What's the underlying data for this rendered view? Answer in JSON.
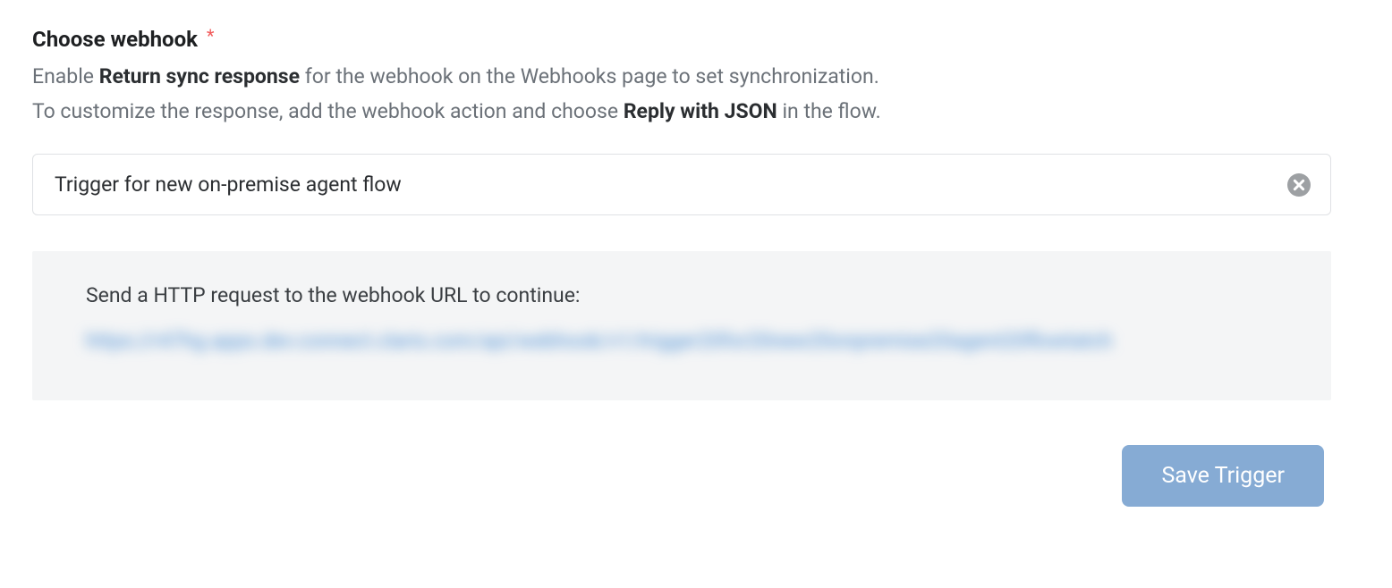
{
  "section": {
    "label": "Choose webhook",
    "required_mark": "*",
    "help_prefix": "Enable ",
    "help_bold1": "Return sync response",
    "help_mid1": " for the webhook on the Webhooks page to set synchronization.",
    "help_line2_pre": "To customize the response, add the webhook action and choose ",
    "help_bold2": "Reply with JSON",
    "help_line2_post": " in the flow."
  },
  "select": {
    "value": "Trigger for new on-premise agent flow"
  },
  "info": {
    "label": "Send a HTTP request to the webhook URL to continue:",
    "url_redacted": "https://r47hg.apps.dev.connect.claris.com/api/webhook/v1/trigger20for20new20onpremise20agent20flowtatch"
  },
  "actions": {
    "save_label": "Save Trigger"
  }
}
